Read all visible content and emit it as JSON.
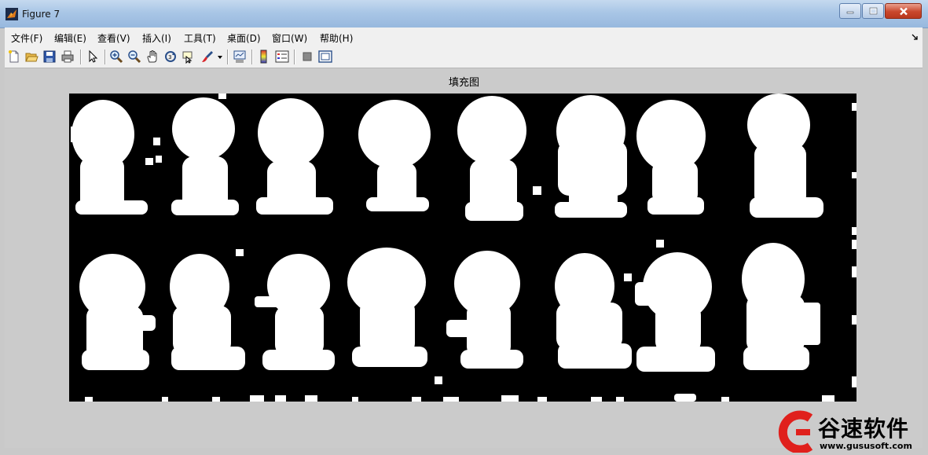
{
  "window": {
    "title": "Figure 7"
  },
  "menu": [
    "文件(F)",
    "编辑(E)",
    "查看(V)",
    "插入(I)",
    "工具(T)",
    "桌面(D)",
    "窗口(W)",
    "帮助(H)"
  ],
  "axes": {
    "title": "填充图"
  },
  "watermark": {
    "brand": "谷速软件",
    "url": "www.gususoft.com"
  },
  "colors": {
    "plot_background": "#000000",
    "foreground": "#ffffff",
    "figure_background": "#cbcbcb",
    "watermark_red": "#e0201c"
  }
}
